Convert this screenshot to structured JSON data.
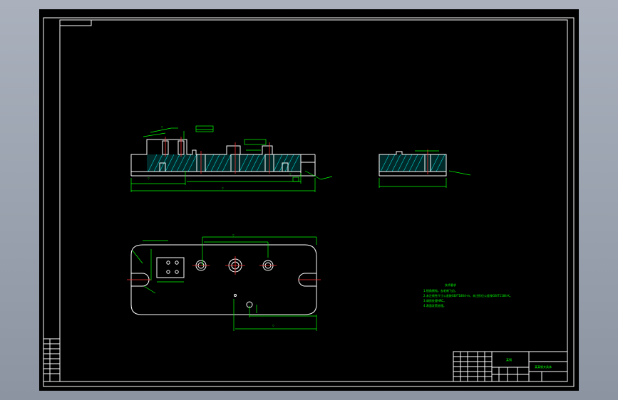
{
  "drawing": {
    "colors": {
      "background": "#000000",
      "outline": "#ffffff",
      "dimension": "#00ff00",
      "hatch": "#00d0d0",
      "centerline": "#ff3030"
    },
    "title_block": {
      "part_name": "某钢",
      "drawing_title": "某某钢夹具体"
    },
    "tech_notes": {
      "heading": "技术要求",
      "lines": [
        "1.锐角倒钝，去毛刺飞边。",
        "2.未注线性尺寸公差按GB/T1804-m，未注形位公差按GB/T1184-K。",
        "3.调质处理HRC。",
        "4.表面发黑处理。"
      ]
    }
  }
}
